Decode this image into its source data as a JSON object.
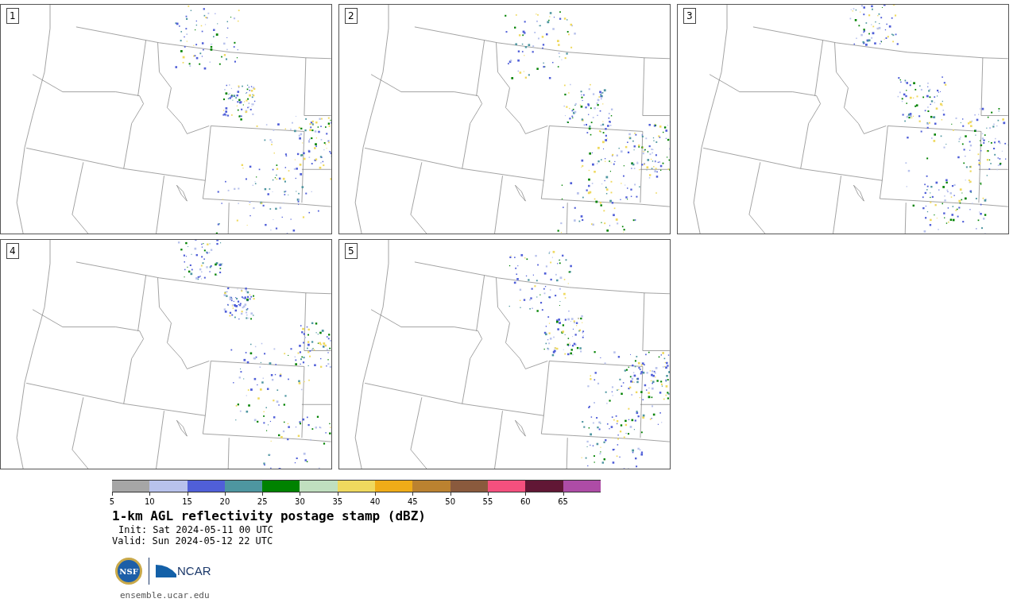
{
  "panels": [
    {
      "label": "1"
    },
    {
      "label": "2"
    },
    {
      "label": "3"
    },
    {
      "label": "4"
    },
    {
      "label": "5"
    }
  ],
  "colorbar": {
    "segments": [
      {
        "color": "#a6a6a6",
        "tick": "5"
      },
      {
        "color": "#b8c2ec",
        "tick": "10"
      },
      {
        "color": "#505fd8",
        "tick": "15"
      },
      {
        "color": "#4e96a0",
        "tick": "20"
      },
      {
        "color": "#008200",
        "tick": "25"
      },
      {
        "color": "#c0dfbf",
        "tick": "30"
      },
      {
        "color": "#efd95e",
        "tick": "35"
      },
      {
        "color": "#efac18",
        "tick": "40"
      },
      {
        "color": "#bb8230",
        "tick": "45"
      },
      {
        "color": "#8a5a3d",
        "tick": "50"
      },
      {
        "color": "#f4507e",
        "tick": "55"
      },
      {
        "color": "#611735",
        "tick": "60"
      },
      {
        "color": "#ae4ca6",
        "tick": "65"
      }
    ]
  },
  "title": "1-km AGL reflectivity postage stamp (dBZ)",
  "init": "Init: Sat 2024-05-11 00 UTC",
  "valid": "Valid: Sun 2024-05-12 22 UTC",
  "logos": {
    "nsf": "NSF",
    "ncar": "NCAR"
  },
  "url": "ensemble.ucar.edu"
}
